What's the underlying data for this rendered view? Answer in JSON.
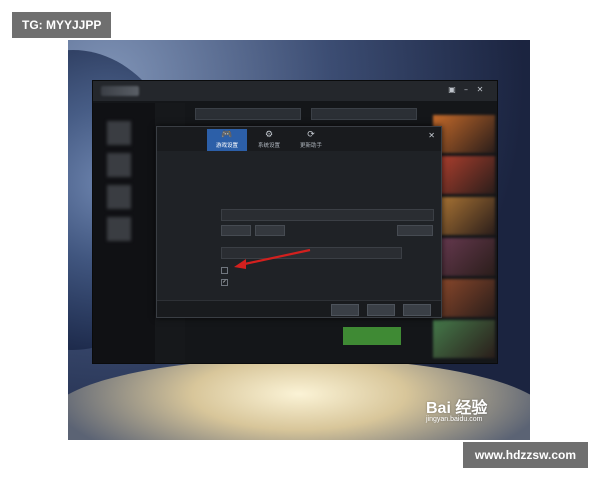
{
  "watermarks": {
    "top_left": "TG: MYYJJPP",
    "bottom_right": "www.hdzzsw.com",
    "baidu_logo": "Bai 经验",
    "baidu_url": "jingyan.baidu.com"
  },
  "app": {
    "side_items": [
      "",
      "",
      "",
      "",
      "",
      ""
    ],
    "tiles": [
      "#c46a2a",
      "#b5412f",
      "#b27a36",
      "#6a3b53",
      "#8f4a2c",
      "#44794a"
    ]
  },
  "dialog": {
    "tabs": [
      {
        "label": "游戏设置",
        "icon": "gamepad-icon",
        "glyph": "🎮",
        "active": true
      },
      {
        "label": "系统设置",
        "icon": "gear-icon",
        "glyph": "⚙",
        "active": false
      },
      {
        "label": "更新助手",
        "icon": "sync-icon",
        "glyph": "⟳",
        "active": false
      }
    ]
  },
  "colors": {
    "accent": "#2c5fa8",
    "warning_text": "#e0a44a",
    "launch": "#3f8a34",
    "arrow": "#d3201e"
  }
}
